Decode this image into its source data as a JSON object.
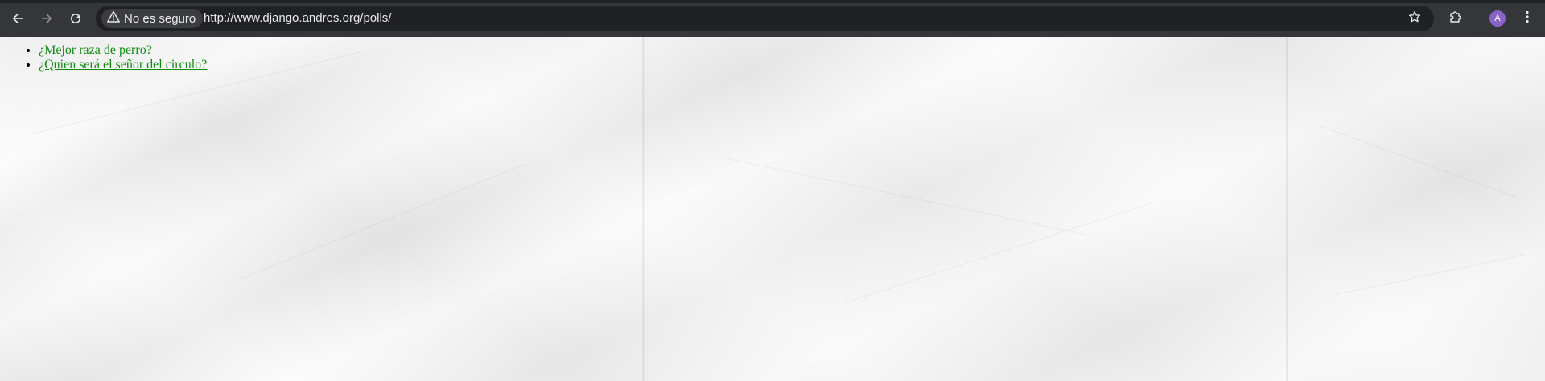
{
  "browser": {
    "security_label": "No es seguro",
    "url": "http://www.django.andres.org/polls/",
    "profile_initial": "A",
    "icons": {
      "back": "arrow-left-icon",
      "forward": "arrow-right-icon",
      "reload": "reload-icon",
      "security": "warning-triangle-icon",
      "bookmark": "star-icon",
      "extensions": "puzzle-icon",
      "menu": "kebab-menu-icon"
    },
    "colors": {
      "toolbar": "#35363a",
      "omnibox": "#202124",
      "avatar": "#8a63c9"
    }
  },
  "page": {
    "polls": [
      {
        "label": "¿Mejor raza de perro?"
      },
      {
        "label": "¿Quien será el señor del circulo?"
      }
    ],
    "colors": {
      "link": "#118a11",
      "background": "#f3f3f3"
    }
  }
}
